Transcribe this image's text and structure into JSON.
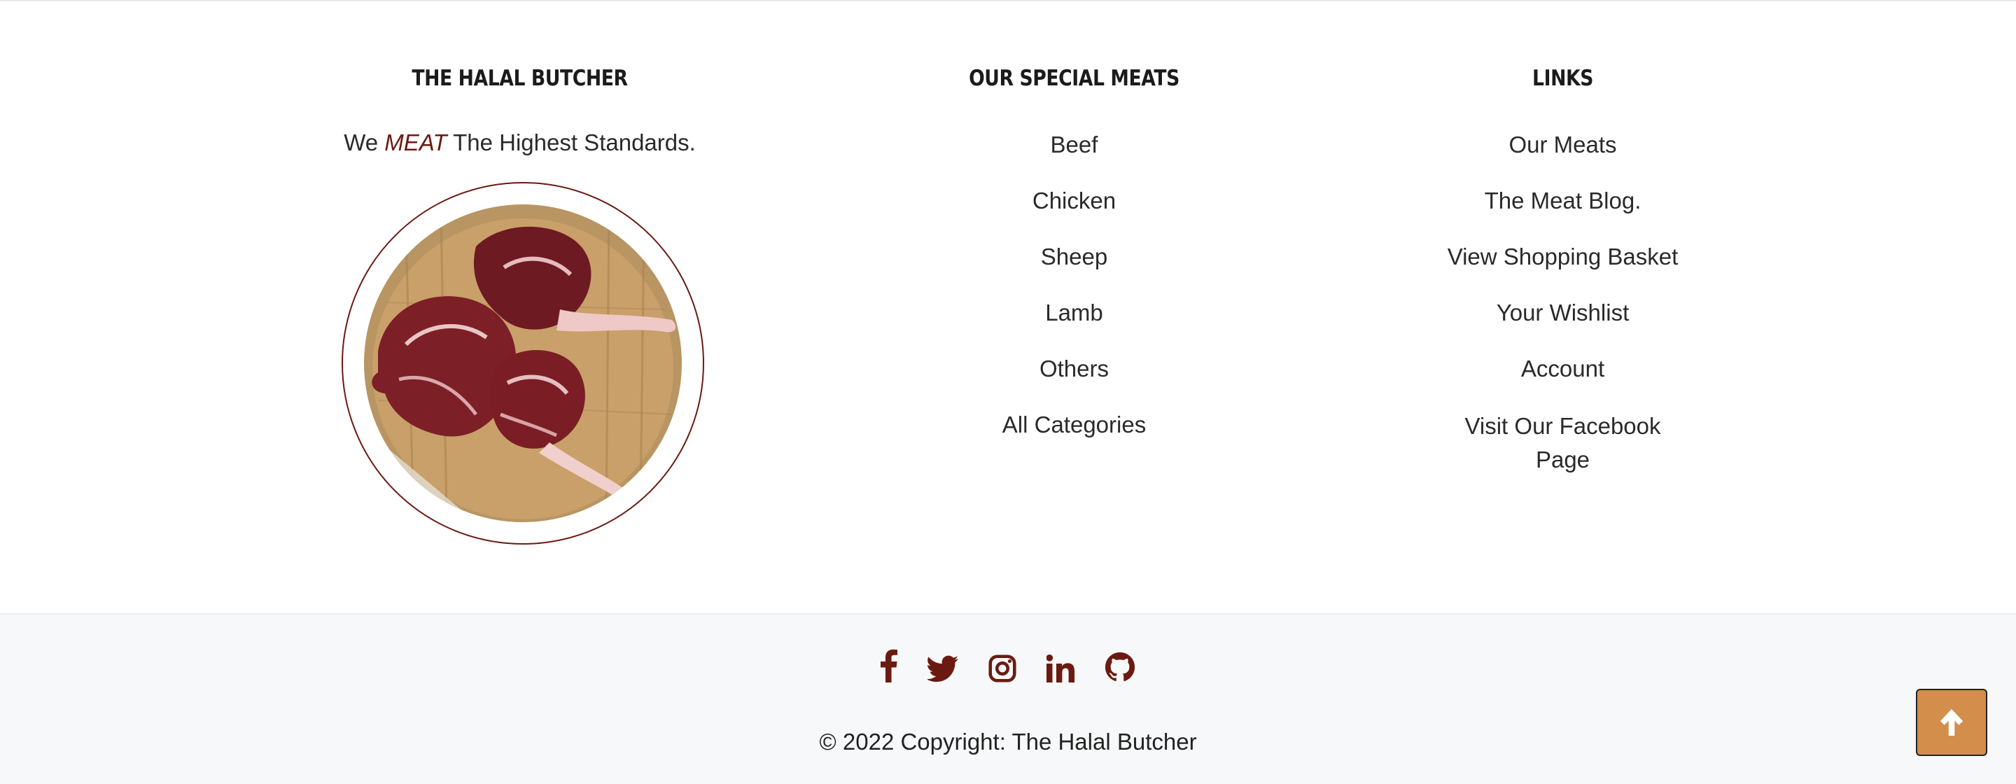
{
  "about": {
    "heading": "THE HALAL BUTCHER",
    "tagline_pre": "We",
    "tagline_accent": "MEAT",
    "tagline_post": "The Highest Standards.",
    "image_icon": "meat-cuts-on-board-photo"
  },
  "special_meats": {
    "heading": "OUR SPECIAL MEATS",
    "items": [
      "Beef",
      "Chicken",
      "Sheep",
      "Lamb",
      "Others",
      "All Categories"
    ]
  },
  "links": {
    "heading": "LINKS",
    "items": [
      "Our Meats",
      "The Meat Blog.",
      "View Shopping Basket",
      "Your Wishlist",
      "Account",
      "Visit Our Facebook Page"
    ]
  },
  "social": {
    "icons": [
      "facebook-icon",
      "twitter-icon",
      "instagram-icon",
      "linkedin-icon",
      "github-icon"
    ]
  },
  "copyright": "© 2022 Copyright: The Halal Butcher",
  "back_to_top": {
    "icon": "arrow-up-icon"
  },
  "colors": {
    "accent": "#6b1a12",
    "button": "#d28e4a",
    "footer_bg": "#f7f8f9"
  }
}
